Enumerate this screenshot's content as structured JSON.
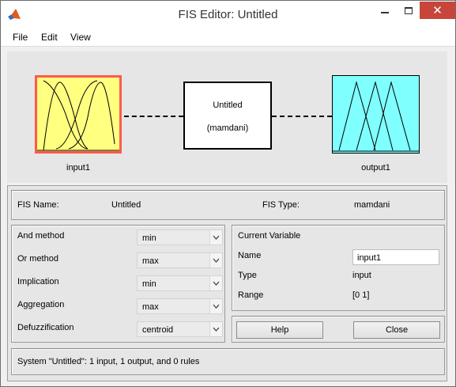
{
  "window": {
    "title": "FIS Editor: Untitled",
    "icons": {
      "app": "matlab-logo-icon",
      "minimize": "minimize-icon",
      "maximize": "maximize-icon",
      "close": "close-icon"
    }
  },
  "menu": {
    "file": "File",
    "edit": "Edit",
    "view": "View"
  },
  "diagram": {
    "input_label": "input1",
    "output_label": "output1",
    "rule_name": "Untitled",
    "rule_type": "(mamdani)"
  },
  "fis_info": {
    "name_label": "FIS Name:",
    "name_value": "Untitled",
    "type_label": "FIS Type:",
    "type_value": "mamdani"
  },
  "methods": {
    "and": {
      "label": "And method",
      "value": "min"
    },
    "or": {
      "label": "Or method",
      "value": "max"
    },
    "implication": {
      "label": "Implication",
      "value": "min"
    },
    "aggregation": {
      "label": "Aggregation",
      "value": "max"
    },
    "defuzz": {
      "label": "Defuzzification",
      "value": "centroid"
    }
  },
  "current_variable": {
    "title": "Current Variable",
    "name_label": "Name",
    "name_value": "input1",
    "type_label": "Type",
    "type_value": "input",
    "range_label": "Range",
    "range_value": "[0 1]"
  },
  "buttons": {
    "help": "Help",
    "close": "Close"
  },
  "status": "System \"Untitled\": 1 input, 1 output, and 0 rules",
  "colors": {
    "input_fill": "#ffff80",
    "input_border": "#ff5a4a",
    "output_fill": "#80ffff",
    "close_button": "#c7453a"
  }
}
